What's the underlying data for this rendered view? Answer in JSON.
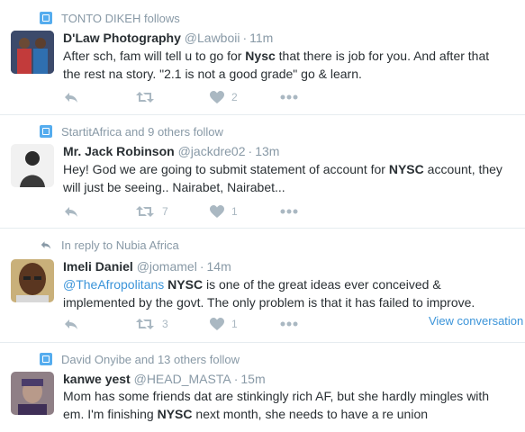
{
  "tweets": [
    {
      "context": "TONTO DIKEH follows",
      "context_icon": "follow-badge-icon",
      "name": "D'Law Photography",
      "handle": "@Lawboii",
      "time": "11m",
      "text_parts": [
        "After sch, fam will tell u to go for ",
        "Nysc",
        " that there is job for you. And after that",
        "the rest na story. \"2.1 is not a good grade\" go & learn."
      ],
      "retweets": "",
      "likes": "2"
    },
    {
      "context": "StartitAfrica and 9 others follow",
      "context_icon": "follow-badge-icon",
      "name": "Mr. Jack Robinson",
      "handle": "@jackdre02",
      "time": "13m",
      "text_parts": [
        "Hey! God we are going to submit statement of account for ",
        "NYSC",
        " account, they",
        "will just be seeing.. Nairabet, Nairabet..."
      ],
      "retweets": "7",
      "likes": "1"
    },
    {
      "context": "In reply to Nubia Africa",
      "context_icon": "reply-arrow-icon",
      "name": "Imeli Daniel",
      "handle": "@jomamel",
      "time": "14m",
      "text_parts": [
        "@TheAfropolitans",
        "NYSC",
        " is one of the great ideas ever conceived &",
        "implemented by the govt. The only problem is that it has failed to improve."
      ],
      "retweets": "3",
      "likes": "1",
      "view_conversation": "View conversation"
    },
    {
      "context": "David Onyibe and 13 others follow",
      "context_icon": "follow-badge-icon",
      "name": "kanwe yest",
      "handle": "@HEAD_MASTA",
      "time": "15m",
      "text_parts": [
        "Mom has some friends dat are stinkingly rich AF, but she hardly mingles with",
        "em. I'm finishing ",
        "NYSC",
        " next month, she needs to have a re union"
      ]
    }
  ],
  "separator": "·",
  "colors": {
    "link": "#3b94d9",
    "muted": "#8899a6",
    "icon": "#aab8c2",
    "badge": "#55acee"
  }
}
